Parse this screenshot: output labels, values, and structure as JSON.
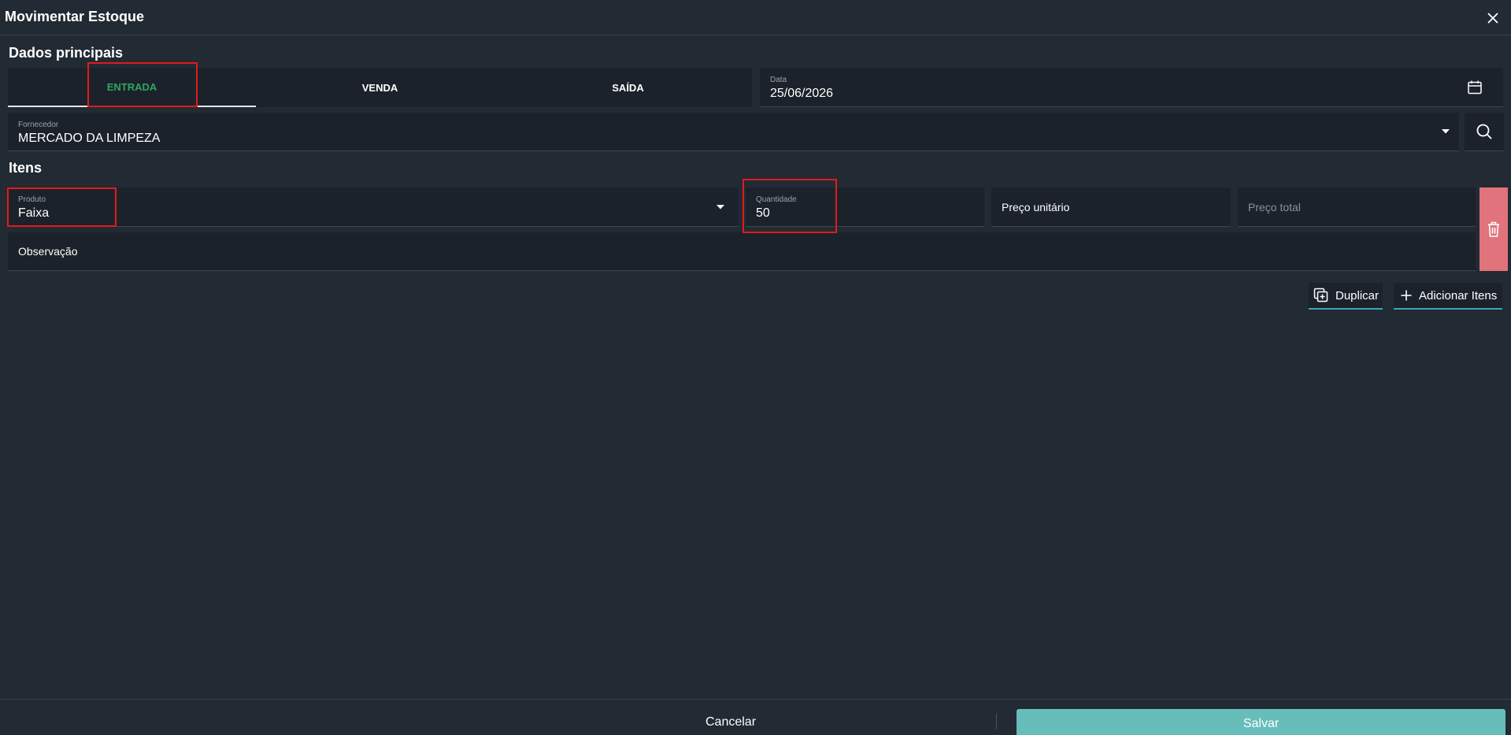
{
  "dialog": {
    "title": "Movimentar Estoque"
  },
  "main_section": {
    "title": "Dados principais",
    "tabs": [
      {
        "label": "ENTRADA",
        "active": true
      },
      {
        "label": "VENDA",
        "active": false
      },
      {
        "label": "SAÍDA",
        "active": false
      }
    ],
    "date": {
      "label": "Data",
      "value": "25/06/2026"
    },
    "supplier": {
      "label": "Fornecedor",
      "value": "MERCADO DA LIMPEZA"
    }
  },
  "items_section": {
    "title": "Itens",
    "product": {
      "label": "Produto",
      "value": "Faixa"
    },
    "quantity": {
      "label": "Quantidade",
      "value": "50"
    },
    "unit_price": {
      "placeholder": "Preço unitário"
    },
    "total_price": {
      "placeholder": "Preço total"
    },
    "observation": {
      "placeholder": "Observação"
    },
    "duplicate_label": "Duplicar",
    "add_items_label": "Adicionar Itens"
  },
  "footer": {
    "cancel_label": "Cancelar",
    "save_label": "Salvar"
  },
  "colors": {
    "background": "#222a34",
    "field": "#1b222b",
    "active_tab": "#2fa55f",
    "delete": "#e0737b",
    "save": "#67bdb9",
    "highlight": "#e11b1b"
  }
}
